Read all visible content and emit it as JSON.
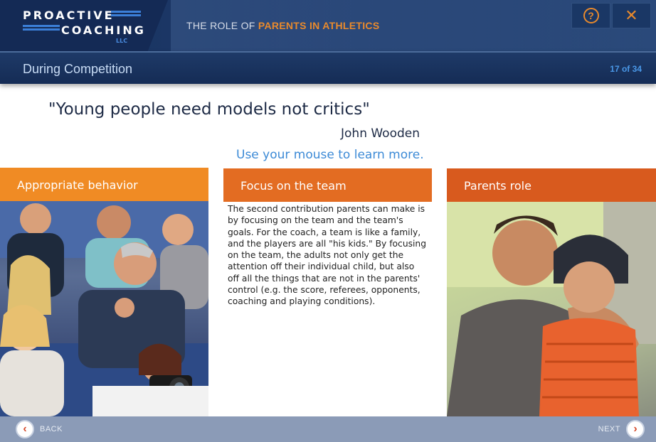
{
  "header": {
    "logo_line1": "PROACTIVE",
    "logo_line2": "COACHING",
    "logo_llc": "LLC",
    "course_title_prefix": "THE ROLE OF ",
    "course_title_accent": "PARENTS IN ATHLETICS",
    "help_icon": "?",
    "close_icon": "✕"
  },
  "subheader": {
    "section_title": "During Competition",
    "page_counter": "17 of 34"
  },
  "quote": {
    "text": "\"Young people need models not critics\"",
    "author": "John Wooden",
    "instruction": "Use your mouse to learn more."
  },
  "cards": [
    {
      "title": "Appropriate behavior",
      "image": "cheering-crowd-photo"
    },
    {
      "title": "Focus on the team",
      "body": "The second contribution parents can make is by focusing on the team and the team's goals. For the coach, a team is like a family, and the players are all \"his kids.\" By focusing on the team, the adults not only get the attention off their individual child, but also off all the things that are not in the parents' control (e.g. the score, referees, opponents, coaching and playing conditions)."
    },
    {
      "title": "Parents role",
      "image": "father-and-son-photo"
    }
  ],
  "footer": {
    "back_label": "BACK",
    "next_label": "NEXT",
    "back_icon": "‹",
    "next_icon": "›"
  },
  "colors": {
    "header_bg": "#17305c",
    "accent_orange": "#e98a2c",
    "card1": "#f08b24",
    "card2": "#e36c22",
    "card3": "#d85a1e",
    "footer_bg": "#8b9bb7"
  }
}
